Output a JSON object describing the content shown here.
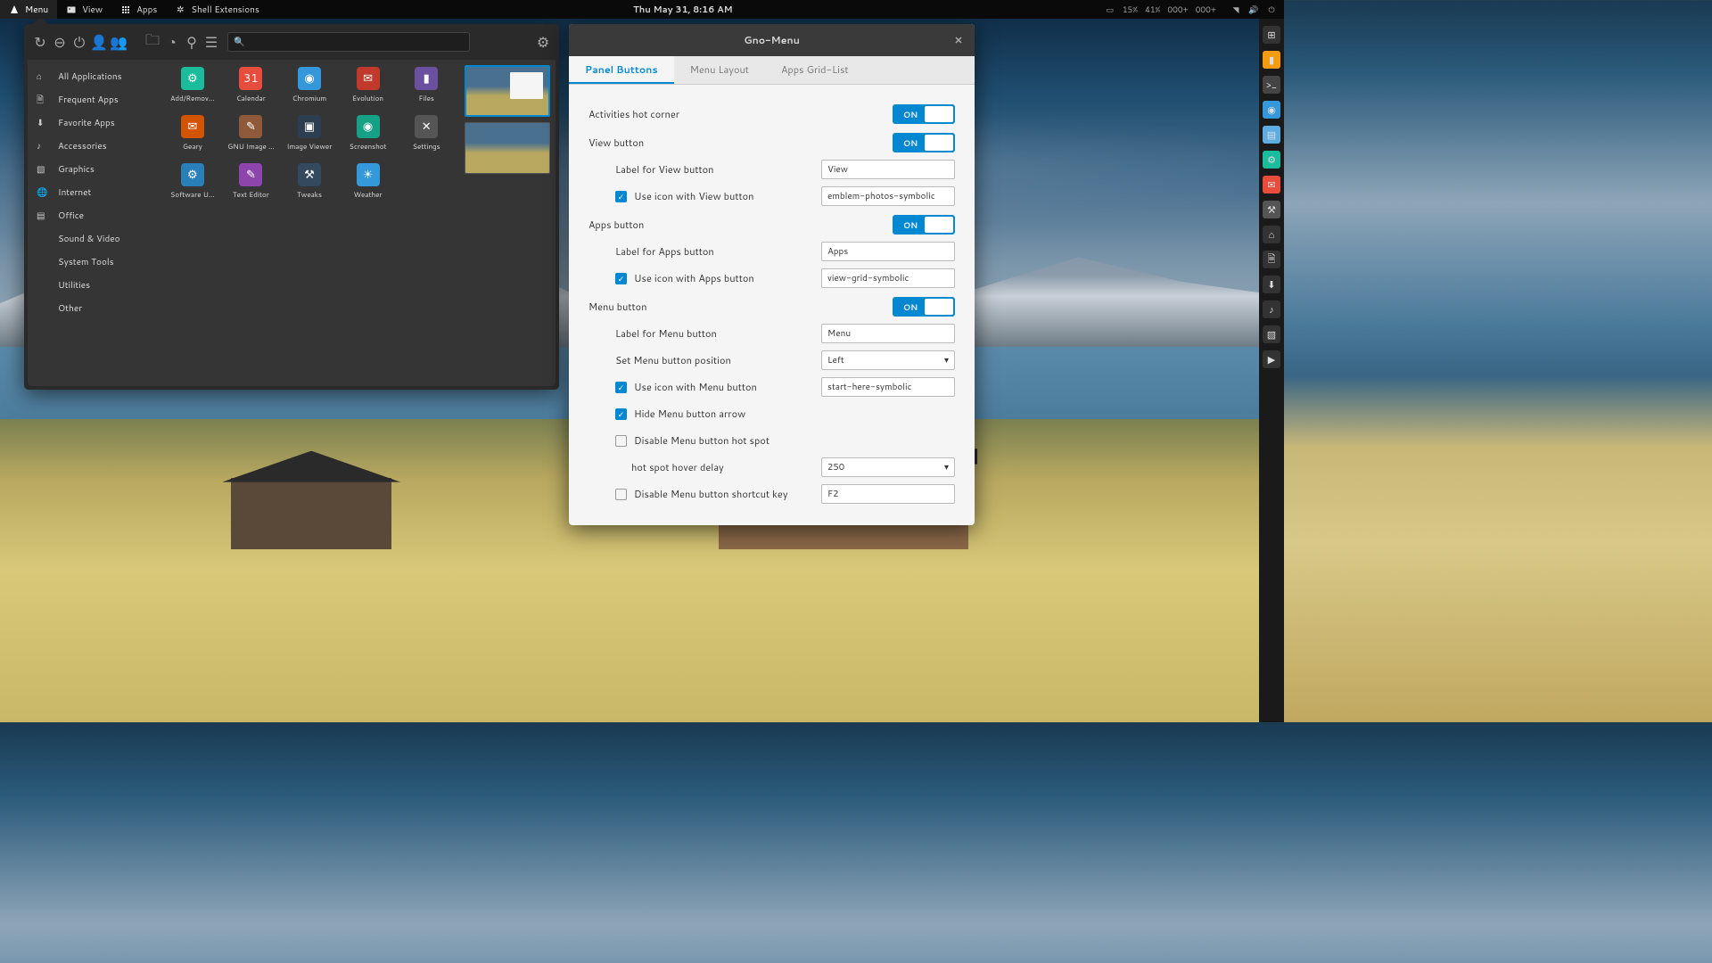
{
  "topbar": {
    "menu_label": "Menu",
    "view_label": "View",
    "apps_label": "Apps",
    "ext_label": "Shell Extensions",
    "clock": "Thu May 31,  8:16 AM",
    "battery_pct": "15%",
    "net_pct": "41%",
    "down": "000+",
    "up": "000+"
  },
  "menuwin": {
    "categories": [
      {
        "icon": "home",
        "label": "All Applications"
      },
      {
        "icon": "doc",
        "label": "Frequent Apps"
      },
      {
        "icon": "download",
        "label": "Favorite Apps"
      },
      {
        "icon": "music",
        "label": "Accessories"
      },
      {
        "icon": "graphics",
        "label": "Graphics"
      },
      {
        "icon": "globe",
        "label": "Internet"
      },
      {
        "icon": "office",
        "label": "Office"
      },
      {
        "icon": "",
        "label": "Sound & Video"
      },
      {
        "icon": "",
        "label": "System Tools"
      },
      {
        "icon": "",
        "label": "Utilities"
      },
      {
        "icon": "",
        "label": "Other"
      }
    ],
    "apps": [
      {
        "label": "Add/Remov...",
        "bg": "#1abc9c",
        "glyph": "⚙"
      },
      {
        "label": "Calendar",
        "bg": "#e74c3c",
        "glyph": "31"
      },
      {
        "label": "Chromium",
        "bg": "#3498db",
        "glyph": "◉"
      },
      {
        "label": "Evolution",
        "bg": "#c0392b",
        "glyph": "✉"
      },
      {
        "label": "Files",
        "bg": "#6b4fa0",
        "glyph": "▮"
      },
      {
        "label": "Geary",
        "bg": "#d35400",
        "glyph": "✉"
      },
      {
        "label": "GNU Image ...",
        "bg": "#8e5a3a",
        "glyph": "✎"
      },
      {
        "label": "Image Viewer",
        "bg": "#2c3e50",
        "glyph": "▣"
      },
      {
        "label": "Screenshot",
        "bg": "#16a085",
        "glyph": "◉"
      },
      {
        "label": "Settings",
        "bg": "#555",
        "glyph": "✕"
      },
      {
        "label": "Software U...",
        "bg": "#2980b9",
        "glyph": "⚙"
      },
      {
        "label": "Text Editor",
        "bg": "#8e44ad",
        "glyph": "✎"
      },
      {
        "label": "Tweaks",
        "bg": "#34495e",
        "glyph": "⚒"
      },
      {
        "label": "Weather",
        "bg": "#3498db",
        "glyph": "☀"
      }
    ]
  },
  "dialog": {
    "title": "Gno-Menu",
    "tabs": [
      "Panel Buttons",
      "Menu Layout",
      "Apps Grid-List"
    ],
    "activities_label": "Activities hot corner",
    "view_section": "View button",
    "view_label_label": "Label for View button",
    "view_label_value": "View",
    "view_useicon_label": "Use icon with View button",
    "view_icon_value": "emblem-photos-symbolic",
    "apps_section": "Apps button",
    "apps_label_label": "Label for Apps button",
    "apps_label_value": "Apps",
    "apps_useicon_label": "Use icon with Apps button",
    "apps_icon_value": "view-grid-symbolic",
    "menu_section": "Menu button",
    "menu_label_label": "Label for Menu button",
    "menu_label_value": "Menu",
    "menu_pos_label": "Set Menu button position",
    "menu_pos_value": "Left",
    "menu_useicon_label": "Use icon with Menu button",
    "menu_icon_value": "start-here-symbolic",
    "hide_arrow_label": "Hide Menu button arrow",
    "disable_hotspot_label": "Disable Menu button hot spot",
    "hover_delay_label": "hot spot hover delay",
    "hover_delay_value": "250",
    "disable_shortcut_label": "Disable Menu button shortcut key",
    "shortcut_value": "F2",
    "on_label": "ON"
  },
  "dock": [
    {
      "name": "overview",
      "bg": "#333",
      "glyph": "⊞"
    },
    {
      "name": "files",
      "bg": "#f39c12",
      "glyph": "▮"
    },
    {
      "name": "terminal",
      "bg": "#444",
      "glyph": ">_"
    },
    {
      "name": "chromium",
      "bg": "#3498db",
      "glyph": "◉"
    },
    {
      "name": "desktop",
      "bg": "#5dade2",
      "glyph": "▤"
    },
    {
      "name": "software",
      "bg": "#1abc9c",
      "glyph": "⚙"
    },
    {
      "name": "geary",
      "bg": "#e74c3c",
      "glyph": "✉"
    },
    {
      "name": "tweaks",
      "bg": "#555",
      "glyph": "⚒"
    },
    {
      "name": "home",
      "bg": "#333",
      "glyph": "⌂"
    },
    {
      "name": "documents",
      "bg": "#333",
      "glyph": "🗎"
    },
    {
      "name": "downloads",
      "bg": "#333",
      "glyph": "⬇"
    },
    {
      "name": "music",
      "bg": "#333",
      "glyph": "♪"
    },
    {
      "name": "pictures",
      "bg": "#333",
      "glyph": "▧"
    },
    {
      "name": "videos",
      "bg": "#333",
      "glyph": "▶"
    }
  ]
}
